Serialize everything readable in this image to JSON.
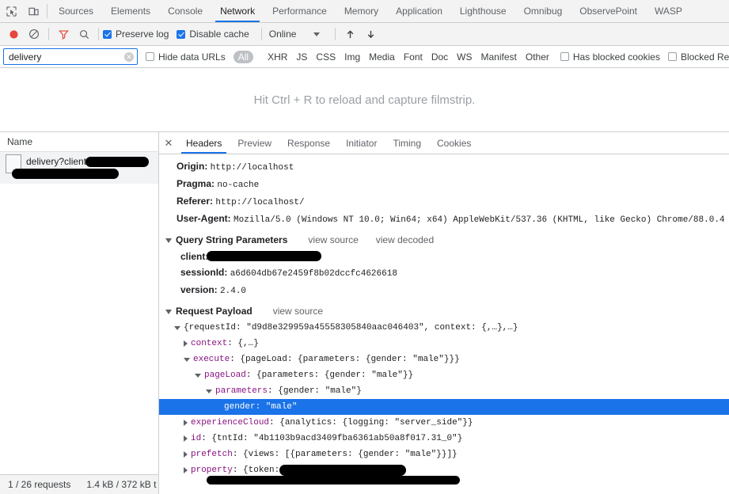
{
  "main_tabs": [
    {
      "label": "Sources",
      "active": false
    },
    {
      "label": "Elements",
      "active": false
    },
    {
      "label": "Console",
      "active": false
    },
    {
      "label": "Network",
      "active": true
    },
    {
      "label": "Performance",
      "active": false
    },
    {
      "label": "Memory",
      "active": false
    },
    {
      "label": "Application",
      "active": false
    },
    {
      "label": "Lighthouse",
      "active": false
    },
    {
      "label": "Omnibug",
      "active": false
    },
    {
      "label": "ObservePoint",
      "active": false
    },
    {
      "label": "WASP",
      "active": false
    }
  ],
  "toolbar": {
    "record_icon": "record-icon",
    "clear_icon": "clear-icon",
    "filter_icon": "filter-funnel-icon",
    "search_icon": "search-icon",
    "preserve_log_label": "Preserve log",
    "preserve_log_checked": true,
    "disable_cache_label": "Disable cache",
    "disable_cache_checked": true,
    "throttle_value": "Online",
    "import_icon": "import-har-icon",
    "export_icon": "export-har-icon",
    "record_color": "#e8453c",
    "filter_color": "#e8453c",
    "checkbox_color": "#1a73e8"
  },
  "filter": {
    "value": "delivery",
    "placeholder": "Filter",
    "clear_icon": "clear-filter-icon",
    "hide_data_urls_label": "Hide data URLs",
    "hide_data_urls_checked": false,
    "types": [
      {
        "label": "All",
        "selected": true
      },
      {
        "label": "XHR",
        "selected": false
      },
      {
        "label": "JS",
        "selected": false
      },
      {
        "label": "CSS",
        "selected": false
      },
      {
        "label": "Img",
        "selected": false
      },
      {
        "label": "Media",
        "selected": false
      },
      {
        "label": "Font",
        "selected": false
      },
      {
        "label": "Doc",
        "selected": false
      },
      {
        "label": "WS",
        "selected": false
      },
      {
        "label": "Manifest",
        "selected": false
      },
      {
        "label": "Other",
        "selected": false
      }
    ],
    "has_blocked_cookies_label": "Has blocked cookies",
    "has_blocked_cookies_checked": false,
    "blocked_requests_label": "Blocked Requests",
    "blocked_requests_checked": false
  },
  "filmstrip": {
    "message": "Hit Ctrl + R to reload and capture filmstrip."
  },
  "request_list": {
    "column_header": "Name",
    "rows": [
      {
        "name": "delivery?client",
        "redacted": true
      }
    ]
  },
  "statusbar": {
    "requests": "1 / 26 requests",
    "transferred": "1.4 kB / 372 kB t"
  },
  "detail": {
    "close_icon": "close-icon",
    "tabs": [
      {
        "label": "Headers",
        "active": true
      },
      {
        "label": "Preview",
        "active": false
      },
      {
        "label": "Response",
        "active": false
      },
      {
        "label": "Initiator",
        "active": false
      },
      {
        "label": "Timing",
        "active": false
      },
      {
        "label": "Cookies",
        "active": false
      }
    ],
    "headers": [
      {
        "key": "Origin:",
        "value": "http://localhost"
      },
      {
        "key": "Pragma:",
        "value": "no-cache"
      },
      {
        "key": "Referer:",
        "value": "http://localhost/"
      },
      {
        "key": "User-Agent:",
        "value": "Mozilla/5.0 (Windows NT 10.0; Win64; x64) AppleWebKit/537.36 (KHTML, like Gecko) Chrome/88.0.4"
      }
    ],
    "query_string": {
      "title": "Query String Parameters",
      "view_source": "view source",
      "view_decoded": "view decoded",
      "params": [
        {
          "key": "client:",
          "value": "",
          "redacted": true
        },
        {
          "key": "sessionId:",
          "value": "a6d604db67e2459f8b02dccfc4626618",
          "redacted": false
        },
        {
          "key": "version:",
          "value": "2.4.0",
          "redacted": false
        }
      ]
    },
    "request_payload": {
      "title": "Request Payload",
      "view_source": "view source",
      "nodes": [
        {
          "indent": 0,
          "tri": "open",
          "text": "{requestId: \"d9d8e329959a45558305840aac046403\", context: {,…},…}",
          "selected": false,
          "redacted": false
        },
        {
          "indent": 1,
          "tri": "closed",
          "key": "context",
          "rest": ": {,…}",
          "selected": false,
          "redacted": false
        },
        {
          "indent": 1,
          "tri": "open",
          "key": "execute",
          "rest": ": {pageLoad: {parameters: {gender: \"male\"}}}",
          "selected": false,
          "redacted": false
        },
        {
          "indent": 2,
          "tri": "open",
          "key": "pageLoad",
          "rest": ": {parameters: {gender: \"male\"}}",
          "selected": false,
          "redacted": false
        },
        {
          "indent": 3,
          "tri": "open",
          "key": "parameters",
          "rest": ": {gender: \"male\"}",
          "selected": false,
          "redacted": false
        },
        {
          "indent": 4,
          "tri": "none",
          "key": "gender",
          "rest": ": \"male\"",
          "selected": true,
          "redacted": false
        },
        {
          "indent": 1,
          "tri": "closed",
          "key": "experienceCloud",
          "rest": ": {analytics: {logging: \"server_side\"}}",
          "selected": false,
          "redacted": false
        },
        {
          "indent": 1,
          "tri": "closed",
          "key": "id",
          "rest": ": {tntId: \"4b1103b9acd3409fba6361ab50a8f017.31_0\"}",
          "selected": false,
          "redacted": false
        },
        {
          "indent": 1,
          "tri": "closed",
          "key": "prefetch",
          "rest": ": {views: [{parameters: {gender: \"male\"}}]}",
          "selected": false,
          "redacted": false
        },
        {
          "indent": 1,
          "tri": "closed",
          "key": "property",
          "rest": ": {token: ",
          "selected": false,
          "redacted": true
        }
      ],
      "selection_color": "#1a73e8"
    }
  }
}
